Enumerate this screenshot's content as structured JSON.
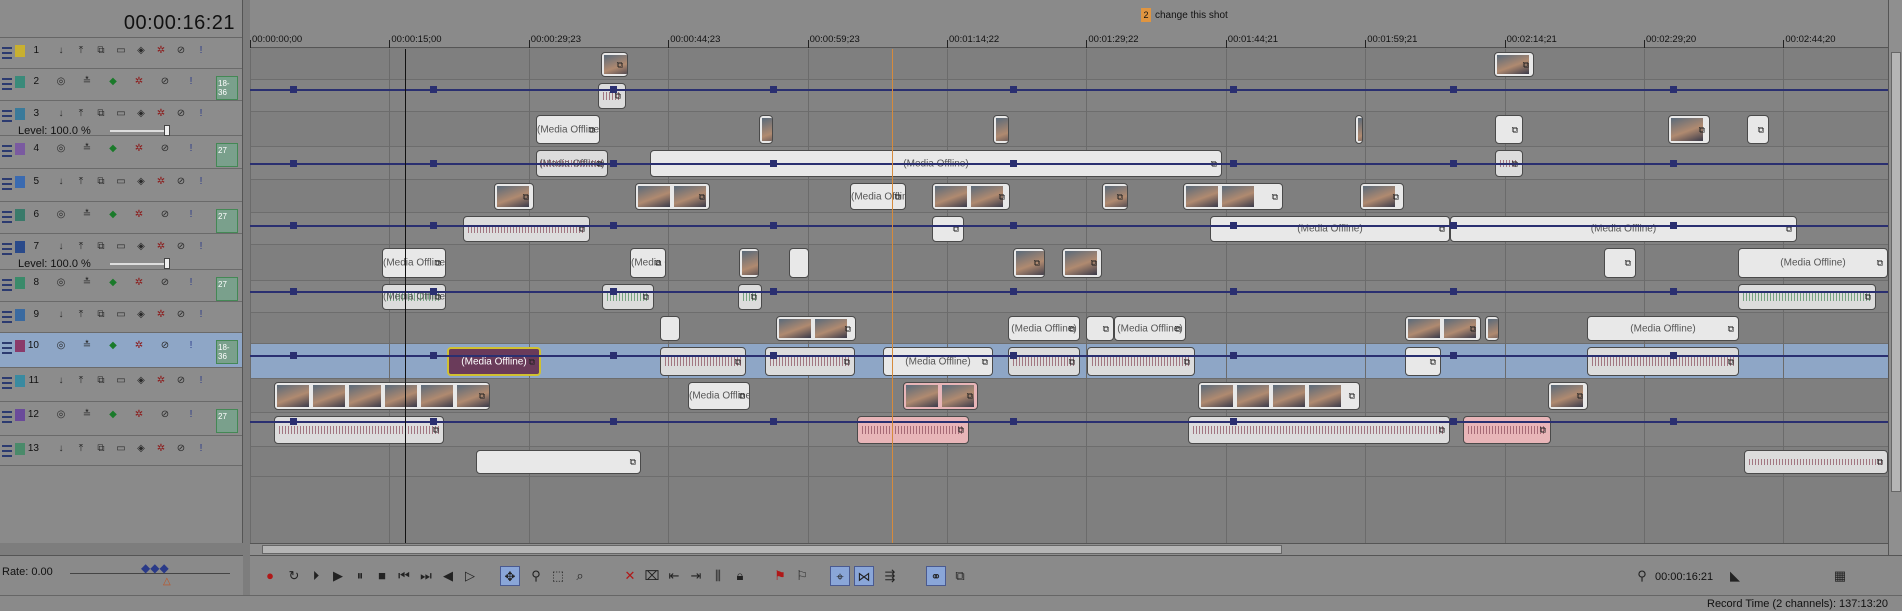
{
  "timecode": "00:00:16:21",
  "ruler": {
    "labels": [
      "00:00:00;00",
      "00:00:15;00",
      "00:00:29;23",
      "00:00:44;23",
      "00:00:59;23",
      "00:01:14;22",
      "00:01:29;22",
      "00:01:44;21",
      "00:01:59;21",
      "00:02:14;21",
      "00:02:29;20",
      "00:02:44;20"
    ],
    "marker_number": "2",
    "marker_label": "change this shot"
  },
  "tracks": [
    {
      "num": "1",
      "color": "#c8b030",
      "type": "video"
    },
    {
      "num": "2",
      "color": "#3a8a7a",
      "type": "audio",
      "thumb": "18-36"
    },
    {
      "num": "3",
      "color": "#3a7a9a",
      "type": "video",
      "level": "Level: 100.0 %"
    },
    {
      "num": "4",
      "color": "#7a5aa0",
      "type": "audio",
      "thumb": "27"
    },
    {
      "num": "5",
      "color": "#3a6ab0",
      "type": "video"
    },
    {
      "num": "6",
      "color": "#3a7a6a",
      "type": "audio",
      "thumb": "27"
    },
    {
      "num": "7",
      "color": "#2a4a8a",
      "type": "video",
      "level": "Level: 100.0 %"
    },
    {
      "num": "8",
      "color": "#3a8a6a",
      "type": "audio",
      "thumb": "27"
    },
    {
      "num": "9",
      "color": "#3a6aa0",
      "type": "video"
    },
    {
      "num": "10",
      "color": "#8a3a6a",
      "type": "audio",
      "thumb": "18-36",
      "selected": true
    },
    {
      "num": "11",
      "color": "#3a8aa0",
      "type": "video"
    },
    {
      "num": "12",
      "color": "#6a4a9a",
      "type": "audio",
      "thumb": "27"
    },
    {
      "num": "13",
      "color": "#4a8a6a",
      "type": "video"
    }
  ],
  "clip_text": "(Media Offline)",
  "rate": "Rate: 0.00",
  "transport_timecode": "00:00:16:21",
  "status": "Record Time (2 channels): 137:13:20",
  "icons": {
    "record": "record-icon",
    "loop": "loop-icon",
    "play-from-start": "play-from-start-icon",
    "play": "play-icon",
    "pause": "pause-icon",
    "stop": "stop-icon",
    "prev": "prev-frame-icon",
    "next": "next-frame-icon",
    "rewind": "rewind-icon",
    "ffwd": "fast-forward-icon"
  }
}
